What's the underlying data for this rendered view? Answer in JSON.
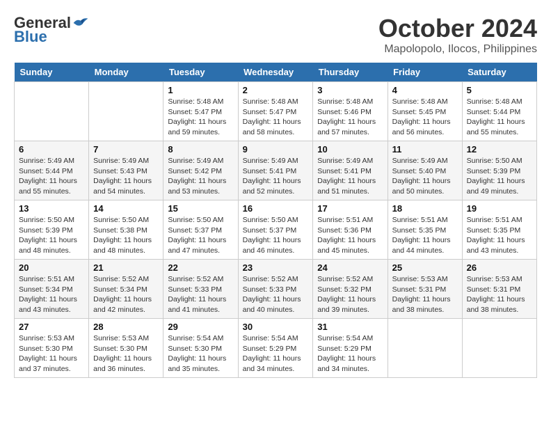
{
  "logo": {
    "general": "General",
    "blue": "Blue"
  },
  "title": "October 2024",
  "location": "Mapolopolo, Ilocos, Philippines",
  "days_of_week": [
    "Sunday",
    "Monday",
    "Tuesday",
    "Wednesday",
    "Thursday",
    "Friday",
    "Saturday"
  ],
  "weeks": [
    [
      {
        "day": "",
        "info": ""
      },
      {
        "day": "",
        "info": ""
      },
      {
        "day": "1",
        "info": "Sunrise: 5:48 AM\nSunset: 5:47 PM\nDaylight: 11 hours and 59 minutes."
      },
      {
        "day": "2",
        "info": "Sunrise: 5:48 AM\nSunset: 5:47 PM\nDaylight: 11 hours and 58 minutes."
      },
      {
        "day": "3",
        "info": "Sunrise: 5:48 AM\nSunset: 5:46 PM\nDaylight: 11 hours and 57 minutes."
      },
      {
        "day": "4",
        "info": "Sunrise: 5:48 AM\nSunset: 5:45 PM\nDaylight: 11 hours and 56 minutes."
      },
      {
        "day": "5",
        "info": "Sunrise: 5:48 AM\nSunset: 5:44 PM\nDaylight: 11 hours and 55 minutes."
      }
    ],
    [
      {
        "day": "6",
        "info": "Sunrise: 5:49 AM\nSunset: 5:44 PM\nDaylight: 11 hours and 55 minutes."
      },
      {
        "day": "7",
        "info": "Sunrise: 5:49 AM\nSunset: 5:43 PM\nDaylight: 11 hours and 54 minutes."
      },
      {
        "day": "8",
        "info": "Sunrise: 5:49 AM\nSunset: 5:42 PM\nDaylight: 11 hours and 53 minutes."
      },
      {
        "day": "9",
        "info": "Sunrise: 5:49 AM\nSunset: 5:41 PM\nDaylight: 11 hours and 52 minutes."
      },
      {
        "day": "10",
        "info": "Sunrise: 5:49 AM\nSunset: 5:41 PM\nDaylight: 11 hours and 51 minutes."
      },
      {
        "day": "11",
        "info": "Sunrise: 5:49 AM\nSunset: 5:40 PM\nDaylight: 11 hours and 50 minutes."
      },
      {
        "day": "12",
        "info": "Sunrise: 5:50 AM\nSunset: 5:39 PM\nDaylight: 11 hours and 49 minutes."
      }
    ],
    [
      {
        "day": "13",
        "info": "Sunrise: 5:50 AM\nSunset: 5:39 PM\nDaylight: 11 hours and 48 minutes."
      },
      {
        "day": "14",
        "info": "Sunrise: 5:50 AM\nSunset: 5:38 PM\nDaylight: 11 hours and 48 minutes."
      },
      {
        "day": "15",
        "info": "Sunrise: 5:50 AM\nSunset: 5:37 PM\nDaylight: 11 hours and 47 minutes."
      },
      {
        "day": "16",
        "info": "Sunrise: 5:50 AM\nSunset: 5:37 PM\nDaylight: 11 hours and 46 minutes."
      },
      {
        "day": "17",
        "info": "Sunrise: 5:51 AM\nSunset: 5:36 PM\nDaylight: 11 hours and 45 minutes."
      },
      {
        "day": "18",
        "info": "Sunrise: 5:51 AM\nSunset: 5:35 PM\nDaylight: 11 hours and 44 minutes."
      },
      {
        "day": "19",
        "info": "Sunrise: 5:51 AM\nSunset: 5:35 PM\nDaylight: 11 hours and 43 minutes."
      }
    ],
    [
      {
        "day": "20",
        "info": "Sunrise: 5:51 AM\nSunset: 5:34 PM\nDaylight: 11 hours and 43 minutes."
      },
      {
        "day": "21",
        "info": "Sunrise: 5:52 AM\nSunset: 5:34 PM\nDaylight: 11 hours and 42 minutes."
      },
      {
        "day": "22",
        "info": "Sunrise: 5:52 AM\nSunset: 5:33 PM\nDaylight: 11 hours and 41 minutes."
      },
      {
        "day": "23",
        "info": "Sunrise: 5:52 AM\nSunset: 5:33 PM\nDaylight: 11 hours and 40 minutes."
      },
      {
        "day": "24",
        "info": "Sunrise: 5:52 AM\nSunset: 5:32 PM\nDaylight: 11 hours and 39 minutes."
      },
      {
        "day": "25",
        "info": "Sunrise: 5:53 AM\nSunset: 5:31 PM\nDaylight: 11 hours and 38 minutes."
      },
      {
        "day": "26",
        "info": "Sunrise: 5:53 AM\nSunset: 5:31 PM\nDaylight: 11 hours and 38 minutes."
      }
    ],
    [
      {
        "day": "27",
        "info": "Sunrise: 5:53 AM\nSunset: 5:30 PM\nDaylight: 11 hours and 37 minutes."
      },
      {
        "day": "28",
        "info": "Sunrise: 5:53 AM\nSunset: 5:30 PM\nDaylight: 11 hours and 36 minutes."
      },
      {
        "day": "29",
        "info": "Sunrise: 5:54 AM\nSunset: 5:30 PM\nDaylight: 11 hours and 35 minutes."
      },
      {
        "day": "30",
        "info": "Sunrise: 5:54 AM\nSunset: 5:29 PM\nDaylight: 11 hours and 34 minutes."
      },
      {
        "day": "31",
        "info": "Sunrise: 5:54 AM\nSunset: 5:29 PM\nDaylight: 11 hours and 34 minutes."
      },
      {
        "day": "",
        "info": ""
      },
      {
        "day": "",
        "info": ""
      }
    ]
  ]
}
